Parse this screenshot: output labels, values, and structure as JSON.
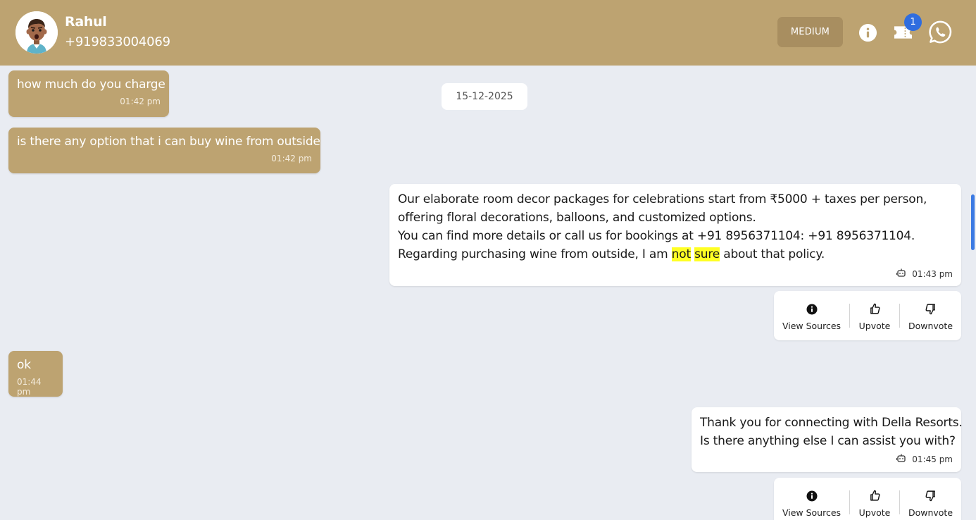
{
  "header": {
    "contact_name": "Rahul",
    "contact_phone": "+919833004069",
    "priority_label": "MEDIUM",
    "ticket_count": "1",
    "background_color": "#bda371"
  },
  "icons": {
    "info": "info-icon",
    "ticket": "ticket-icon",
    "whatsapp": "whatsapp-icon",
    "bot": "bot-icon",
    "thumbs_up": "thumbs-up-icon",
    "thumbs_down": "thumbs-down-icon"
  },
  "date_divider": "15-12-2025",
  "messages": [
    {
      "direction": "incoming",
      "text": "how much do you charge",
      "time": "01:42 pm"
    },
    {
      "direction": "incoming",
      "text": "is there any option that i can buy wine from outside",
      "time": "01:42 pm"
    },
    {
      "direction": "outgoing",
      "lines": [
        "Our elaborate room decor packages for celebrations start from ₹5000 + taxes per person,",
        "offering floral decorations, balloons, and customized options.",
        "You can find more details or call us for bookings at +91 8956371104: +91 8956371104."
      ],
      "last_line": {
        "before": "Regarding purchasing wine from outside, I am ",
        "highlight_1": "not",
        "space": " ",
        "highlight_2": "sure",
        "after": " about that policy."
      },
      "time": "01:43 pm"
    },
    {
      "direction": "incoming",
      "text": "ok",
      "time": "01:44 pm"
    },
    {
      "direction": "outgoing",
      "lines": [
        "Thank you for connecting with Della Resorts.",
        "Is there anything else I can assist you with?"
      ],
      "time": "01:45 pm"
    }
  ],
  "message_actions": {
    "view_sources": "View Sources",
    "upvote": "Upvote",
    "downvote": "Downvote"
  },
  "colors": {
    "incoming_bubble": "#bda371",
    "outgoing_bubble": "#ffffff",
    "highlight": "#ffff24",
    "badge": "#2f6ddf",
    "chat_background": "#e9ecf2"
  }
}
